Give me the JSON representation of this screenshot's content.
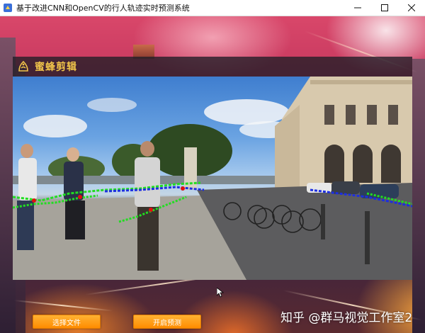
{
  "window": {
    "title": "基于改进CNN和OpenCV的行人轨迹实时预测系统",
    "icons": {
      "app": "app-icon",
      "minimize": "minimize-icon",
      "maximize": "maximize-icon",
      "close": "close-icon"
    }
  },
  "header": {
    "brand_name": "蜜蜂剪辑",
    "brand_icon": "bee-logo-icon",
    "brand_color": "#f0c44a"
  },
  "video": {
    "description_icon": "video-frame",
    "trajectory_colors": {
      "observed": "#22dd22",
      "predicted": "#1c2ee0",
      "current": "#e01010"
    }
  },
  "controls": {
    "select_file_label": "选择文件",
    "start_predict_label": "开启预测",
    "button_color": "#ff9a1a"
  },
  "watermark": {
    "text": "知乎 @群马视觉工作室2"
  }
}
